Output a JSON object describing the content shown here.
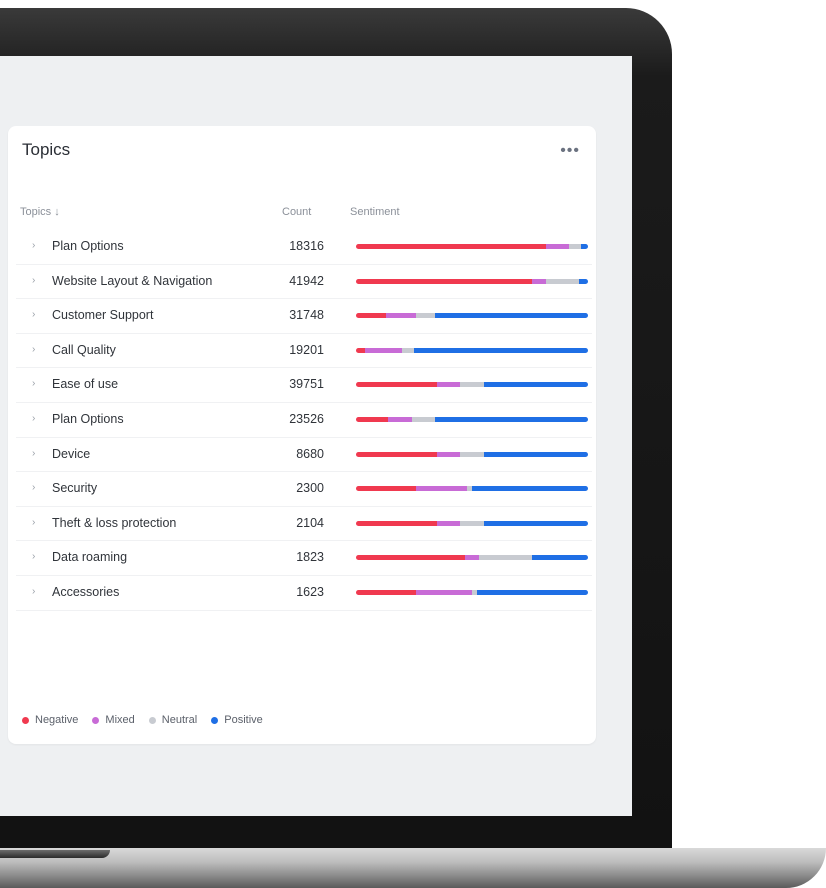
{
  "card": {
    "title": "Topics",
    "more_icon": "ellipsis-icon",
    "more_label": "•••"
  },
  "table": {
    "headers": {
      "topic": "Topics ↓",
      "count": "Count",
      "sentiment": "Sentiment"
    },
    "rows": [
      {
        "topic": "Plan Options",
        "count": "18316",
        "sentiment": [
          0.82,
          0.1,
          0.05,
          0.03
        ]
      },
      {
        "topic": "Website Layout & Navigation",
        "count": "41942",
        "sentiment": [
          0.76,
          0.06,
          0.14,
          0.04
        ]
      },
      {
        "topic": "Customer Support",
        "count": "31748",
        "sentiment": [
          0.13,
          0.13,
          0.08,
          0.66
        ]
      },
      {
        "topic": "Call Quality",
        "count": "19201",
        "sentiment": [
          0.04,
          0.16,
          0.05,
          0.75
        ]
      },
      {
        "topic": "Ease of use",
        "count": "39751",
        "sentiment": [
          0.35,
          0.1,
          0.1,
          0.45
        ]
      },
      {
        "topic": "Plan Options",
        "count": "23526",
        "sentiment": [
          0.14,
          0.1,
          0.1,
          0.66
        ]
      },
      {
        "topic": "Device",
        "count": "8680",
        "sentiment": [
          0.35,
          0.1,
          0.1,
          0.45
        ]
      },
      {
        "topic": "Security",
        "count": "2300",
        "sentiment": [
          0.26,
          0.22,
          0.02,
          0.5
        ]
      },
      {
        "topic": "Theft & loss protection",
        "count": "2104",
        "sentiment": [
          0.35,
          0.1,
          0.1,
          0.45
        ]
      },
      {
        "topic": "Data roaming",
        "count": "1823",
        "sentiment": [
          0.47,
          0.06,
          0.23,
          0.24
        ]
      },
      {
        "topic": "Accessories",
        "count": "1623",
        "sentiment": [
          0.26,
          0.24,
          0.02,
          0.48
        ]
      }
    ]
  },
  "legend": [
    {
      "label": "Negative",
      "color": "#f0394f"
    },
    {
      "label": "Mixed",
      "color": "#c86bd6"
    },
    {
      "label": "Neutral",
      "color": "#c8cbd1"
    },
    {
      "label": "Positive",
      "color": "#1f6fe5"
    }
  ]
}
